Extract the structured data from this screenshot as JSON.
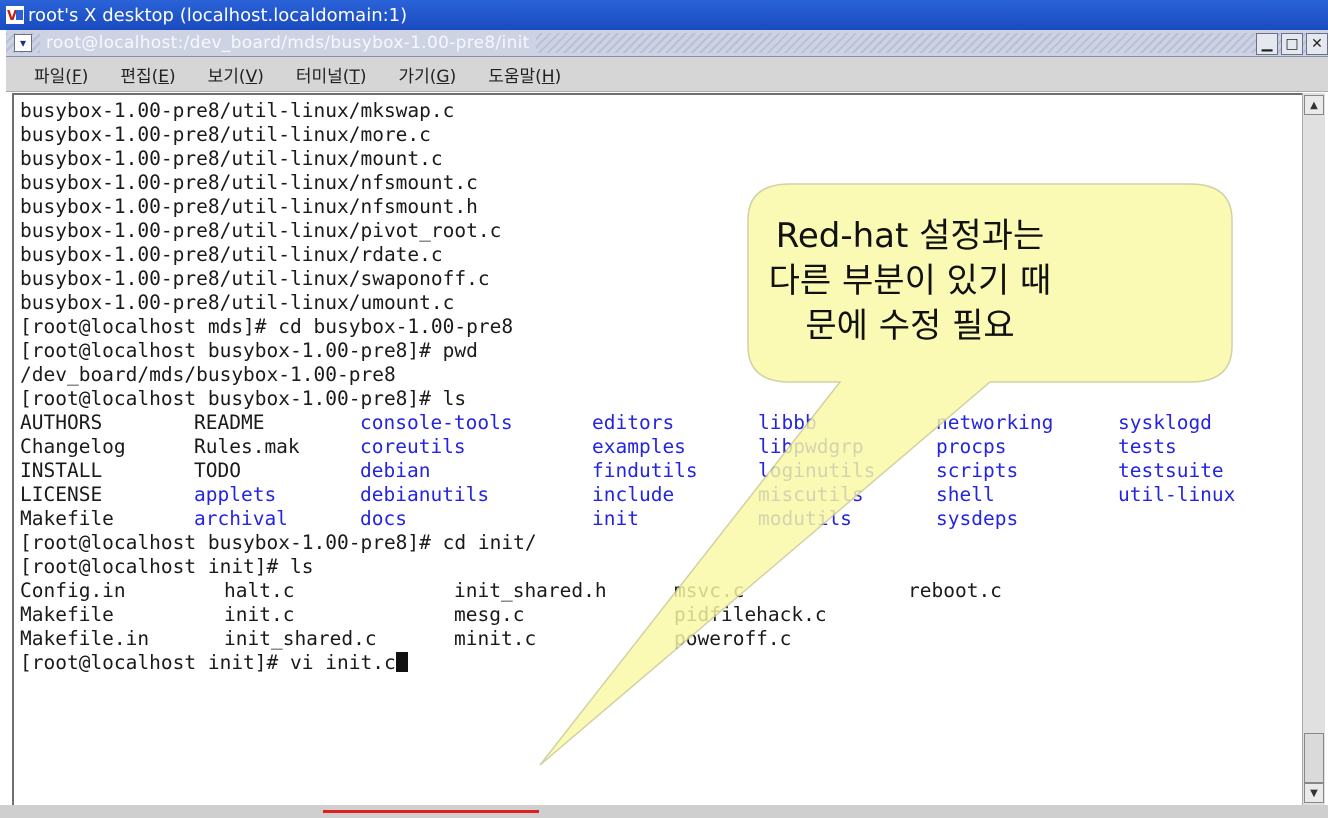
{
  "vnc": {
    "title": "root's X desktop (localhost.localdomain:1)",
    "icon": "vnc-logo-icon"
  },
  "terminal_window": {
    "title": "root@localhost:/dev_board/mds/busybox-1.00-pre8/init",
    "menu_icon": "chevron-down-icon",
    "buttons": [
      "minimize-icon",
      "maximize-icon",
      "close-icon"
    ]
  },
  "menubar": {
    "items": [
      {
        "label": "파일(",
        "mn": "F",
        "end": ")"
      },
      {
        "label": "편집(",
        "mn": "E",
        "end": ")"
      },
      {
        "label": "보기(",
        "mn": "V",
        "end": ")"
      },
      {
        "label": "터미널(",
        "mn": "T",
        "end": ")"
      },
      {
        "label": "가기(",
        "mn": "G",
        "end": ")"
      },
      {
        "label": "도움말(",
        "mn": "H",
        "end": ")"
      }
    ]
  },
  "terminal": {
    "lines": [
      "busybox-1.00-pre8/util-linux/mkswap.c",
      "busybox-1.00-pre8/util-linux/more.c",
      "busybox-1.00-pre8/util-linux/mount.c",
      "busybox-1.00-pre8/util-linux/nfsmount.c",
      "busybox-1.00-pre8/util-linux/nfsmount.h",
      "busybox-1.00-pre8/util-linux/pivot_root.c",
      "busybox-1.00-pre8/util-linux/rdate.c",
      "busybox-1.00-pre8/util-linux/swaponoff.c",
      "busybox-1.00-pre8/util-linux/umount.c",
      "[root@localhost mds]# cd busybox-1.00-pre8",
      "[root@localhost busybox-1.00-pre8]# pwd",
      "/dev_board/mds/busybox-1.00-pre8",
      "[root@localhost busybox-1.00-pre8]# ls"
    ],
    "ls_rows": [
      [
        "AUTHORS",
        "README",
        "console-tools",
        "editors",
        "libbb",
        "networking",
        "sysklogd"
      ],
      [
        "Changelog",
        "Rules.mak",
        "coreutils",
        "examples",
        "libpwdgrp",
        "procps",
        "tests"
      ],
      [
        "INSTALL",
        "TODO",
        "debian",
        "findutils",
        "loginutils",
        "scripts",
        "testsuite"
      ],
      [
        "LICENSE",
        "applets",
        "debianutils",
        "include",
        "miscutils",
        "shell",
        "util-linux"
      ],
      [
        "Makefile",
        "archival",
        "docs",
        "init",
        "modutils",
        "sysdeps",
        ""
      ]
    ],
    "cd_line": "[root@localhost busybox-1.00-pre8]# cd init/",
    "ls2_line": "[root@localhost init]# ls",
    "init_rows": [
      [
        "Config.in",
        "halt.c",
        "init_shared.h",
        "msvc.c",
        "reboot.c"
      ],
      [
        "Makefile",
        "init.c",
        "mesg.c",
        "pidfilehack.c",
        ""
      ],
      [
        "Makefile.in",
        "init_shared.c",
        "minit.c",
        "poweroff.c",
        ""
      ]
    ],
    "prompt_line": "[root@localhost init]# vi init.c"
  },
  "callout": {
    "lines": [
      "Red-hat 설정과는",
      "다른 부분이 있기 때",
      "문에 수정 필요"
    ],
    "fill": "#fafaa6",
    "stroke": "#c8c890"
  },
  "colors": {
    "dir_blue": "#2525e0",
    "highlight_underline": "#e02020"
  }
}
